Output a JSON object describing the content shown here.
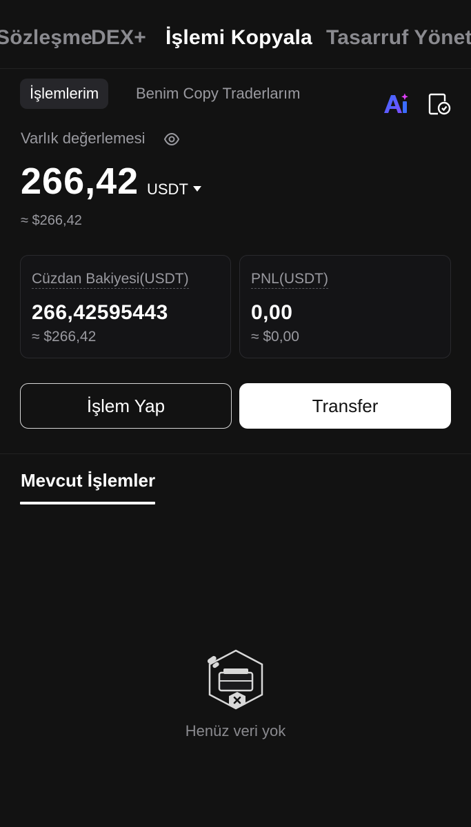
{
  "top_tabs": [
    {
      "label": "Sözleşme"
    },
    {
      "label": "DEX+"
    },
    {
      "label": "İşlemi Kopyala",
      "active": true
    },
    {
      "label": "Tasarruf Yönetimi"
    }
  ],
  "sub_tabs": [
    {
      "label": "İşlemlerim",
      "active": true
    },
    {
      "label": "Benim Copy Traderlarım"
    }
  ],
  "header_icons": {
    "ai": "Ai",
    "doc": "document-clock-icon"
  },
  "valuation": {
    "label": "Varlık değerlemesi",
    "amount": "266,42",
    "currency": "USDT",
    "approx": "≈ $266,42"
  },
  "cards": [
    {
      "label": "Cüzdan Bakiyesi(USDT)",
      "value": "266,42595443",
      "approx": "≈ $266,42"
    },
    {
      "label": "PNL(USDT)",
      "value": "0,00",
      "approx": "≈ $0,00"
    }
  ],
  "buttons": {
    "trade": "İşlem Yap",
    "transfer": "Transfer"
  },
  "positions_tab": "Mevcut İşlemler",
  "empty_state": "Henüz veri yok",
  "colors": {
    "background": "#121212",
    "accent_ai_start": "#3b6cff",
    "accent_ai_end": "#e040fb"
  }
}
